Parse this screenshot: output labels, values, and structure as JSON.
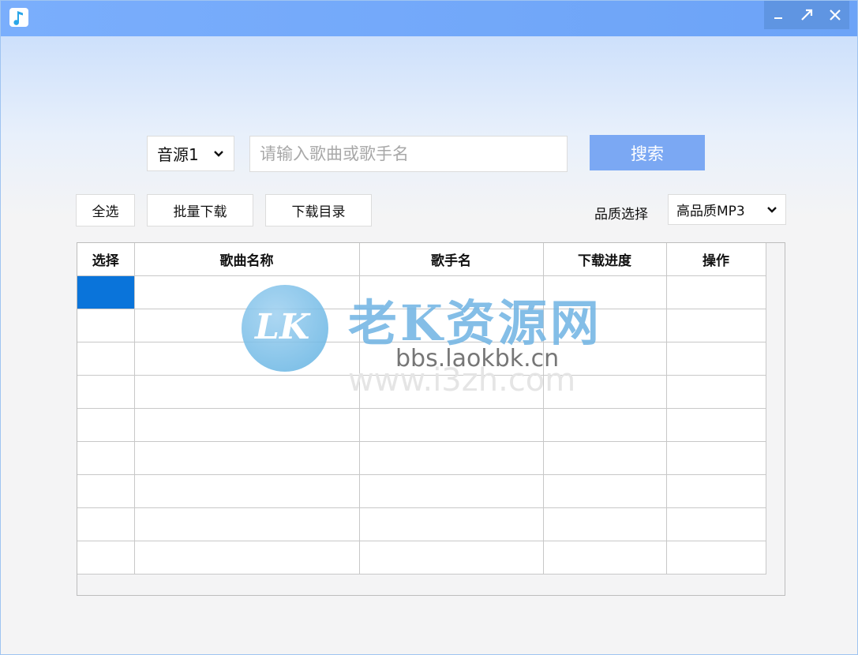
{
  "window": {
    "controls": [
      "minimize",
      "maximize",
      "close"
    ]
  },
  "search": {
    "source_selected": "音源1",
    "placeholder": "请输入歌曲或歌手名",
    "value": "",
    "button_label": "搜索"
  },
  "toolbar": {
    "select_all_label": "全选",
    "batch_download_label": "批量下载",
    "download_dir_label": "下载目录",
    "quality_label": "品质选择",
    "quality_selected": "高品质MP3"
  },
  "table": {
    "headers": [
      "选择",
      "歌曲名称",
      "歌手名",
      "下载进度",
      "操作"
    ],
    "row_count": 9,
    "selected_row": 0
  },
  "watermark": {
    "logo": "LK",
    "title": "老K资源网",
    "site": "bbs.laokbk.cn",
    "ghost": "www.i3zh.com"
  },
  "colors": {
    "titlebar": "#6ca3f7",
    "accent_button": "#7ba8f3",
    "selected_cell": "#0a74da"
  },
  "icons": {
    "app": "music-note-icon",
    "dropdown": "chevron-down-icon",
    "minimize": "minimize-icon",
    "maximize": "maximize-icon",
    "close": "close-icon"
  }
}
